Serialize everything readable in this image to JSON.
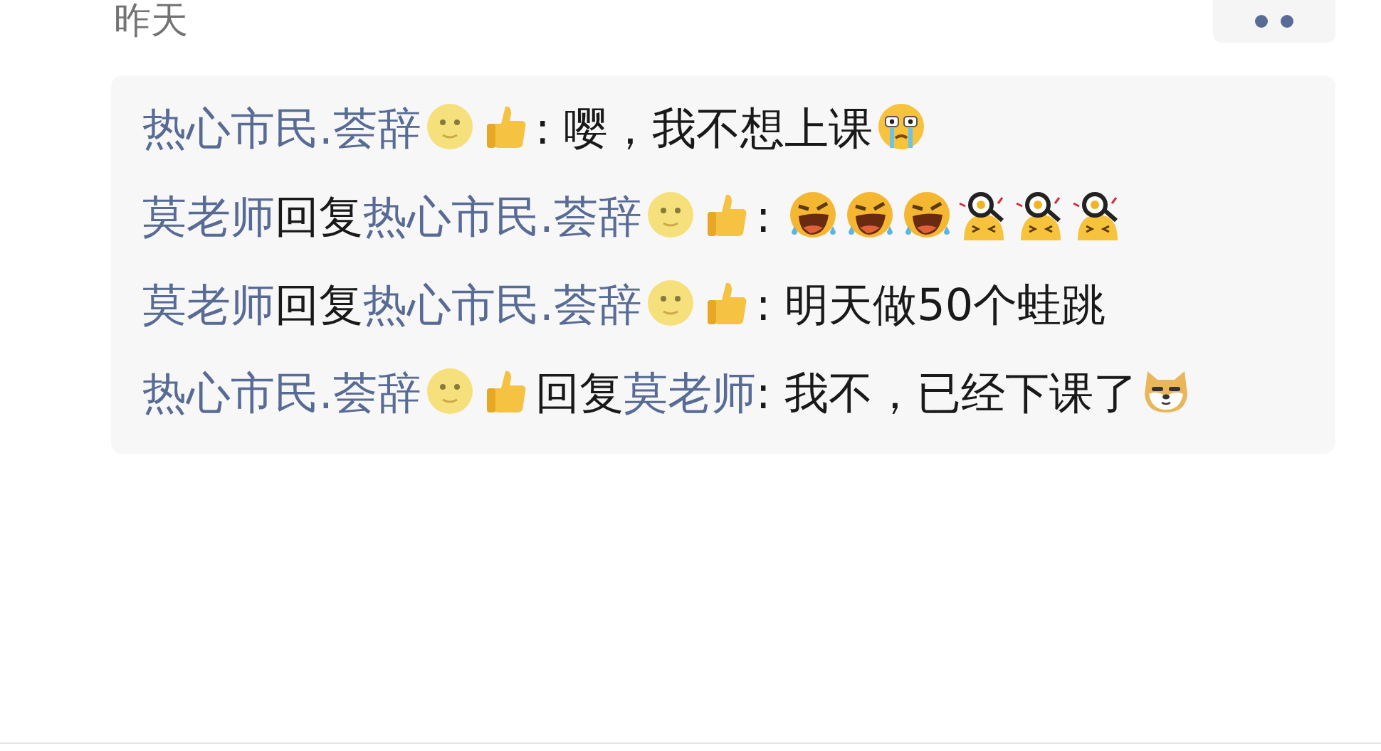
{
  "date": "昨天",
  "comments": [
    {
      "segments": [
        {
          "kind": "name",
          "text": "热心市民.荟辞"
        },
        {
          "kind": "moon"
        },
        {
          "kind": "thumb"
        },
        {
          "kind": "text",
          "text": ": 嘤，我不想上课"
        },
        {
          "kind": "tears"
        }
      ]
    },
    {
      "segments": [
        {
          "kind": "name",
          "text": "莫老师"
        },
        {
          "kind": "text",
          "text": "回复"
        },
        {
          "kind": "name",
          "text": "热心市民.荟辞"
        },
        {
          "kind": "moon"
        },
        {
          "kind": "thumb"
        },
        {
          "kind": "text",
          "text": ": "
        },
        {
          "kind": "laugh-cry"
        },
        {
          "kind": "laugh-cry"
        },
        {
          "kind": "laugh-cry"
        },
        {
          "kind": "pan"
        },
        {
          "kind": "pan"
        },
        {
          "kind": "pan"
        }
      ]
    },
    {
      "segments": [
        {
          "kind": "name",
          "text": "莫老师"
        },
        {
          "kind": "text",
          "text": "回复"
        },
        {
          "kind": "name",
          "text": "热心市民.荟辞"
        },
        {
          "kind": "moon"
        },
        {
          "kind": "thumb"
        },
        {
          "kind": "text",
          "text": ": 明天做50个蛙跳"
        }
      ]
    },
    {
      "segments": [
        {
          "kind": "name",
          "text": "热心市民.荟辞"
        },
        {
          "kind": "moon"
        },
        {
          "kind": "thumb"
        },
        {
          "kind": "text",
          "text": "回复"
        },
        {
          "kind": "name",
          "text": "莫老师"
        },
        {
          "kind": "text",
          "text": ": 我不，已经下课了"
        },
        {
          "kind": "doge"
        }
      ]
    }
  ]
}
